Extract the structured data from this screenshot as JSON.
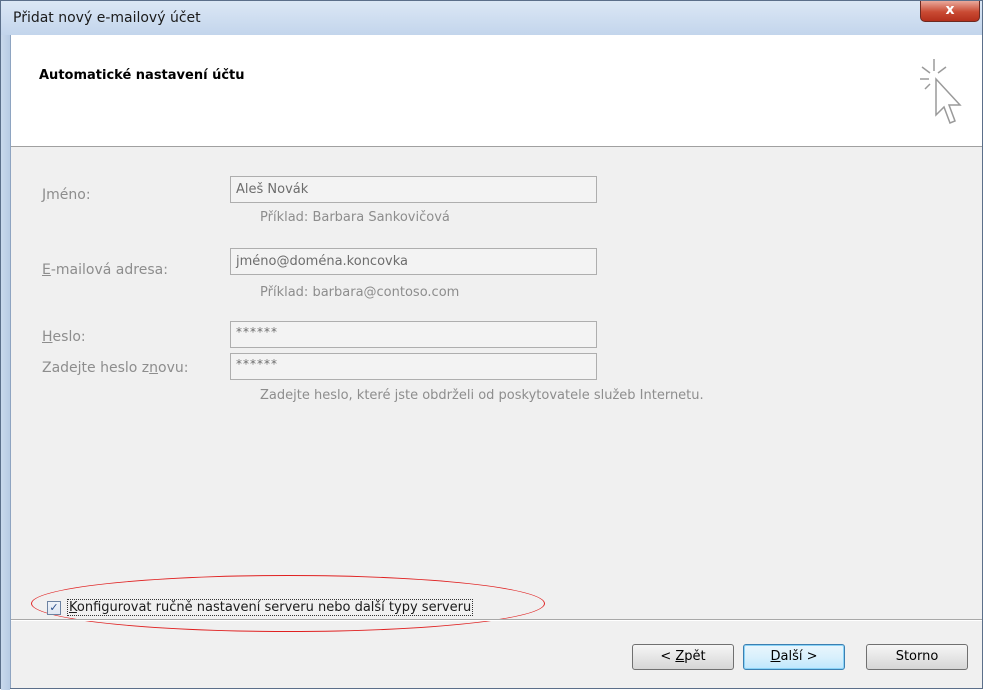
{
  "window": {
    "title": "Přidat nový e-mailový účet",
    "close_glyph": "x"
  },
  "header": {
    "heading": "Automatické nastavení účtu",
    "icon": "sparkle-cursor-icon"
  },
  "form": {
    "name": {
      "label_accel": "J",
      "label_rest": "méno:",
      "value": "Aleš Novák",
      "hint": "Příklad: Barbara Sankovičová"
    },
    "email": {
      "label_accel": "E",
      "label_rest": "-mailová adresa:",
      "value": "jméno@doména.koncovka",
      "hint": "Příklad: barbara@contoso.com"
    },
    "password": {
      "label_accel": "H",
      "label_rest": "eslo:",
      "value": "******"
    },
    "password_confirm": {
      "label_before": "Zadejte heslo z",
      "label_accel": "n",
      "label_after": "ovu:",
      "value": "******",
      "hint": "Zadejte heslo, které jste obdrželi od poskytovatele služeb Internetu."
    }
  },
  "manual_config": {
    "checked": true,
    "check_glyph": "✓",
    "label_accel": "K",
    "label_rest": "onfigurovat ručně nastavení serveru nebo další typy serveru"
  },
  "buttons": {
    "back_prefix": "< ",
    "back_accel": "Z",
    "back_rest": "pět",
    "next_accel": "D",
    "next_rest": "alší >",
    "cancel": "Storno"
  },
  "colors": {
    "annotation_ellipse": "#e02020",
    "disabled_text": "#8d8d8d"
  }
}
